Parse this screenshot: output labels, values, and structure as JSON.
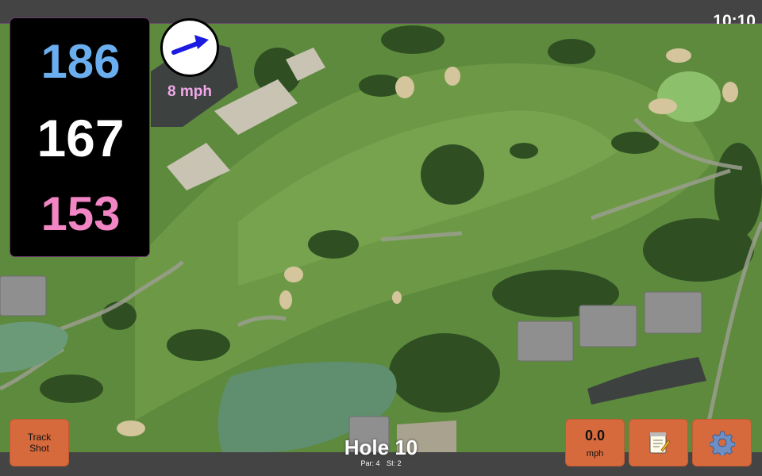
{
  "status_bar": {
    "time": "10:10"
  },
  "yardages": {
    "back": "186",
    "middle": "167",
    "front": "153",
    "colors": {
      "back": "#6aaef0",
      "middle": "#ffffff",
      "front": "#f285c4"
    }
  },
  "wind": {
    "speed": "8 mph",
    "direction_icon": "wind-arrow-icon",
    "color": "#f0a8e8",
    "arrow_color": "#1a1ae0"
  },
  "hole": {
    "title": "Hole 10",
    "par": "Par: 4",
    "si": "SI: 2"
  },
  "buttons": {
    "track_shot_line1": "Track",
    "track_shot_line2": "Shot",
    "speed_value": "0.0",
    "speed_unit": "mph",
    "notes_icon": "notepad-icon",
    "settings_icon": "gear-icon"
  },
  "theme": {
    "button_color": "#d66a3c",
    "bar_color": "#444444"
  }
}
